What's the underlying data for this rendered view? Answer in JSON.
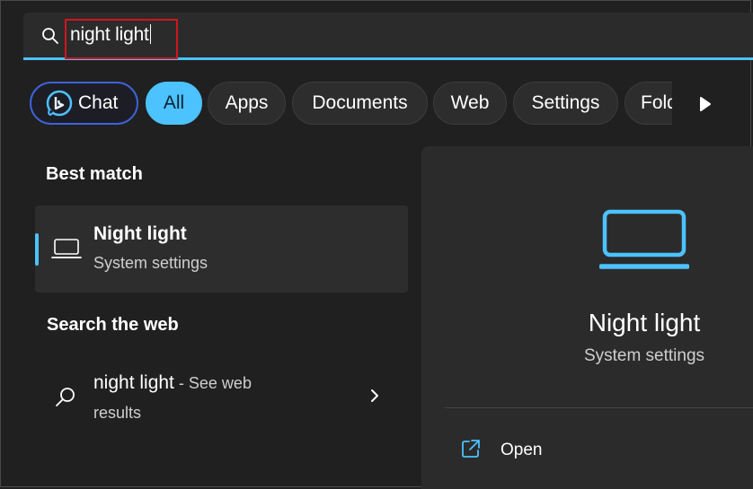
{
  "search": {
    "query": "night light"
  },
  "filters": {
    "chat_label": "Chat",
    "items": [
      "All",
      "Apps",
      "Documents",
      "Web",
      "Settings",
      "Folders"
    ],
    "active": "All"
  },
  "best_match": {
    "heading": "Best match",
    "name": "Night light",
    "subtitle": "System settings",
    "icon": "laptop-icon"
  },
  "web": {
    "heading": "Search the web",
    "query": "night light",
    "suffix": " - See web",
    "suffix2": "results"
  },
  "preview": {
    "title": "Night light",
    "subtitle": "System settings",
    "actions": [
      {
        "label": "Open",
        "icon": "open-external-icon"
      }
    ]
  },
  "colors": {
    "accent": "#4cc2ff",
    "highlight_box": "#d0161c",
    "chat_border": "#3d63d8"
  }
}
